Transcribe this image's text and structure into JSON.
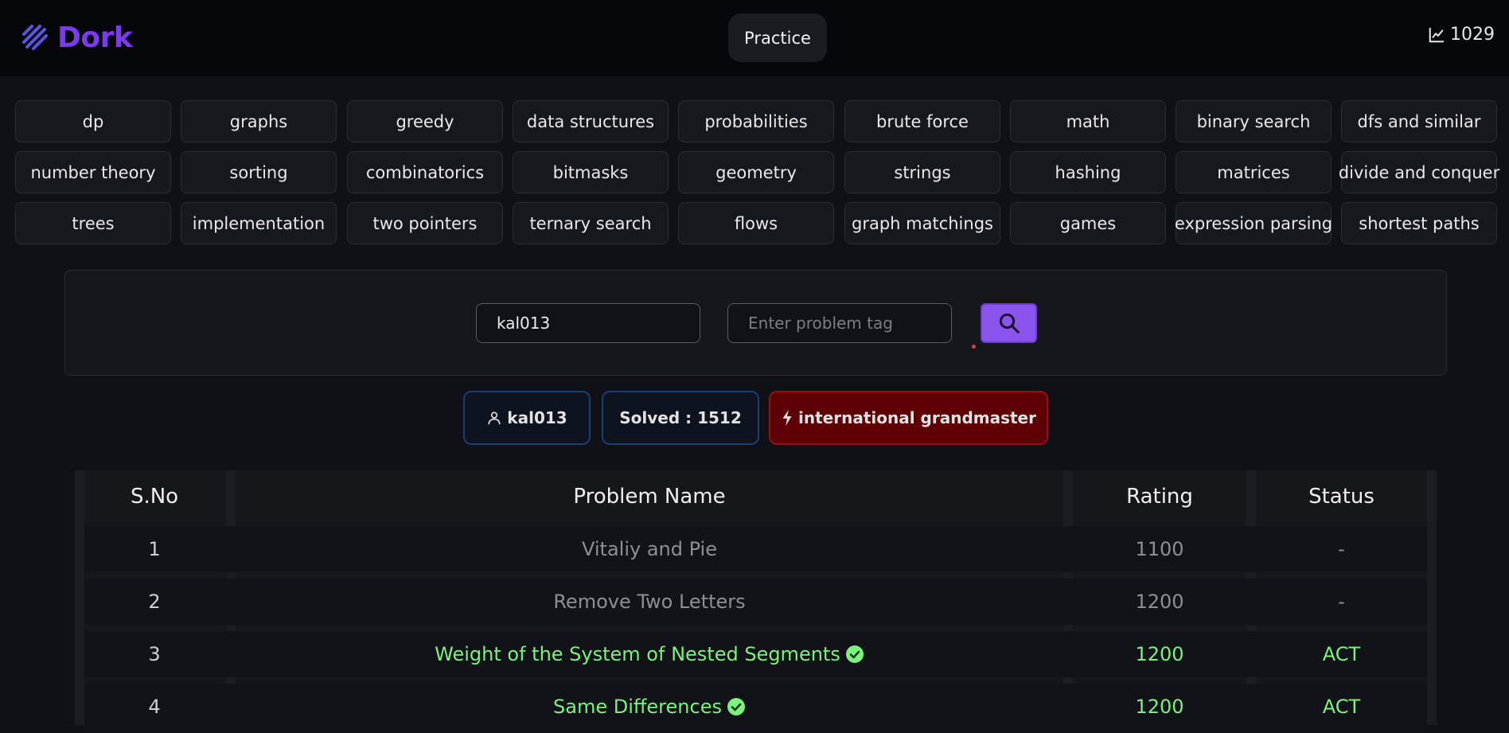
{
  "brand": {
    "name": "Dork"
  },
  "nav": {
    "practice_label": "Practice"
  },
  "header": {
    "rating": "1029"
  },
  "tags": [
    [
      "dp",
      "graphs",
      "greedy",
      "data structures",
      "probabilities",
      "brute force",
      "math",
      "binary search",
      "dfs and similar"
    ],
    [
      "number theory",
      "sorting",
      "combinatorics",
      "bitmasks",
      "geometry",
      "strings",
      "hashing",
      "matrices",
      "divide and conquer"
    ],
    [
      "trees",
      "implementation",
      "two pointers",
      "ternary search",
      "flows",
      "graph matchings",
      "games",
      "expression parsing",
      "shortest paths"
    ]
  ],
  "search": {
    "username_value": "kal013",
    "tag_placeholder": "Enter problem tag"
  },
  "profile": {
    "username": "kal013",
    "solved": "Solved : 1512",
    "rank": "international grandmaster"
  },
  "table": {
    "headers": [
      "S.No",
      "Problem Name",
      "Rating",
      "Status"
    ],
    "rows": [
      {
        "sno": "1",
        "name": "Vitaliy and Pie",
        "rating": "1100",
        "status": "-",
        "solved": false
      },
      {
        "sno": "2",
        "name": "Remove Two Letters",
        "rating": "1200",
        "status": "-",
        "solved": false
      },
      {
        "sno": "3",
        "name": "Weight of the System of Nested Segments",
        "rating": "1200",
        "status": "ACT",
        "solved": true
      },
      {
        "sno": "4",
        "name": "Same Differences",
        "rating": "1200",
        "status": "ACT",
        "solved": true
      }
    ]
  },
  "colors": {
    "accent": "#8b54ec",
    "solved_green": "#7cf27c",
    "rank_red": "#5c0006",
    "badge_blue_border": "#1c3e73"
  },
  "icons": {
    "brand": "dork-logo-icon",
    "rating": "trend-chart-icon",
    "search": "search-icon",
    "user": "user-icon",
    "rank": "lightning-icon",
    "solved": "check-circle-icon"
  }
}
